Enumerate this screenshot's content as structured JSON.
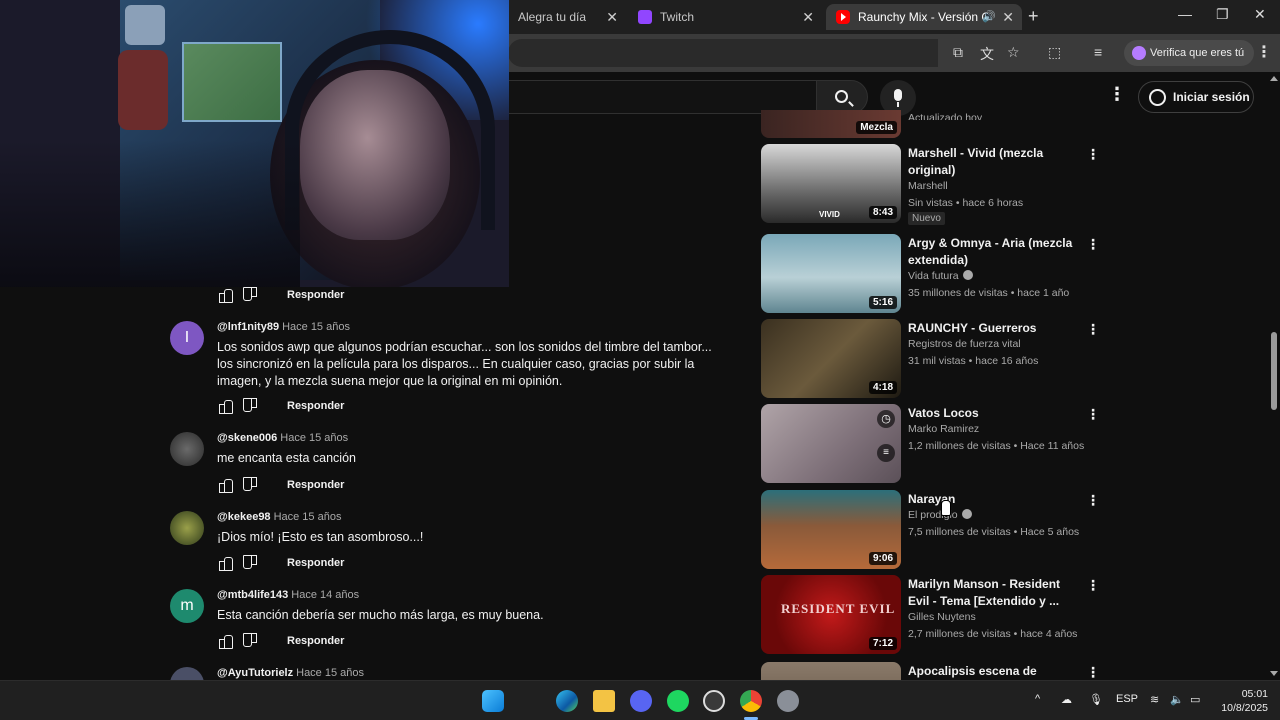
{
  "browser": {
    "tabs": [
      {
        "label": "Alegra tu día",
        "active": false
      },
      {
        "label": "Twitch",
        "active": false
      },
      {
        "label": "Raunchy Mix - Versión Clay",
        "active": true
      }
    ],
    "new_tab": "+",
    "window_controls": {
      "minimize": "—",
      "maximize": "❐",
      "close": "✕"
    },
    "toolbar": {
      "verify_label": "Verifica que eres tú",
      "menu": "⋮"
    }
  },
  "youtube": {
    "search": {
      "placeholder": ""
    },
    "header_menu": "⋮",
    "sign_in_label": "Iniciar sesión",
    "mix_partial": {
      "label": "Mezcla",
      "meta": "Actualizado hoy"
    },
    "recommendations": [
      {
        "title": "Marshell - Vivid (mezcla original)",
        "channel": "Marshell",
        "verified": false,
        "stats": "Sin vistas • hace 6 horas",
        "duration": "8:43",
        "badge": "Nuevo",
        "thumb_overlay": "VIVID"
      },
      {
        "title": "Argy & Omnya - Aria (mezcla extendida)",
        "channel": "Vida futura",
        "verified": true,
        "stats": "35 millones de visitas • hace 1 año",
        "duration": "5:16",
        "badge": ""
      },
      {
        "title": "RAUNCHY - Guerreros",
        "channel": "Registros de fuerza vital",
        "verified": false,
        "stats": "31 mil vistas • hace 16 años",
        "duration": "4:18",
        "badge": ""
      },
      {
        "title": "Vatos Locos",
        "channel": "Marko Ramirez",
        "verified": false,
        "stats": "1,2 millones de visitas • Hace 11 años",
        "duration": "",
        "badge": ""
      },
      {
        "title": "Narayan",
        "channel": "El prodigio",
        "verified": true,
        "stats": "7,5 millones de visitas • Hace 5 años",
        "duration": "9:06",
        "badge": ""
      },
      {
        "title": "Marilyn Manson - Resident Evil - Tema [Extendido y ...",
        "channel": "Gilles Nuytens",
        "verified": false,
        "stats": "2,7 millones de visitas • hace 4 años",
        "duration": "7:12",
        "badge": "",
        "thumb_overlay": "RESIDENT EVIL"
      },
      {
        "title": "Apocalipsis escena de escape",
        "channel": "",
        "verified": false,
        "stats": "",
        "duration": "",
        "badge": ""
      }
    ],
    "reply_label": "Responder",
    "comments": [
      {
        "author": "",
        "time": "",
        "text": "",
        "avatar_letter": "",
        "avatar_color": "#000000"
      },
      {
        "author": "@lnf1nity89",
        "time": "Hace 15 años",
        "text": "Los sonidos awp que algunos podrían escuchar... son los sonidos del timbre del tambor... los sincronizó en la película para los disparos... En cualquier caso, gracias por subir la imagen, y la mezcla suena mejor que la original en mi opinión.",
        "avatar_letter": "I",
        "avatar_color": "#7e57c2"
      },
      {
        "author": "@skene006",
        "time": "Hace 15 años",
        "text": "me encanta esta canción",
        "avatar_letter": "",
        "avatar_color": "#3a3a3a"
      },
      {
        "author": "@kekee98",
        "time": "Hace 15 años",
        "text": "¡Dios mío! ¡Esto es tan asombroso...!",
        "avatar_letter": "",
        "avatar_color": "#4e5a2a"
      },
      {
        "author": "@mtb4life143",
        "time": "Hace 14 años",
        "text": "Esta canción debería ser mucho más larga, es muy buena.",
        "avatar_letter": "m",
        "avatar_color": "#1e8a6e"
      },
      {
        "author": "@AyuTutorielz",
        "time": "Hace 15 años",
        "text": "",
        "avatar_letter": "",
        "avatar_color": "#4a4f66"
      }
    ]
  },
  "taskbar": {
    "language": "ESP",
    "time": "05:01",
    "date": "10/8/2025",
    "tray_chevron": "^"
  }
}
